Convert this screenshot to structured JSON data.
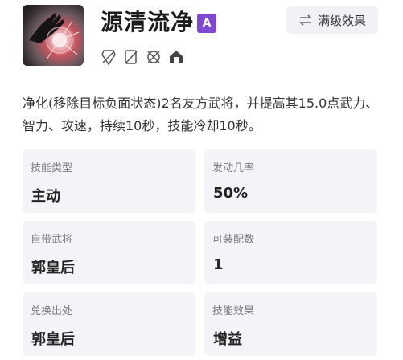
{
  "skill": {
    "name": "源清流净",
    "grade": "A",
    "icon": "skill-portrait-hand-burst",
    "max_button_label": "满级效果",
    "max_button_icon": "swap-arrows-icon",
    "tags": [
      "tag-icon-1",
      "tag-icon-2",
      "tag-icon-3",
      "tag-icon-4"
    ],
    "description": "净化(移除目标负面状态)2名友方武将，并提高其15.0点武力、智力、攻速，持续10秒，技能冷却10秒。"
  },
  "info_cards": [
    {
      "label": "技能类型",
      "value": "主动"
    },
    {
      "label": "发动几率",
      "value": "50%"
    },
    {
      "label": "自带武将",
      "value": "郭皇后"
    },
    {
      "label": "可装配数",
      "value": "1"
    },
    {
      "label": "兑换出处",
      "value": "郭皇后"
    },
    {
      "label": "技能效果",
      "value": "增益"
    }
  ],
  "colors": {
    "grade_badge": "#7f4ad0",
    "card_bg": "#f3f4f7",
    "button_bg": "#f1f2f6"
  }
}
